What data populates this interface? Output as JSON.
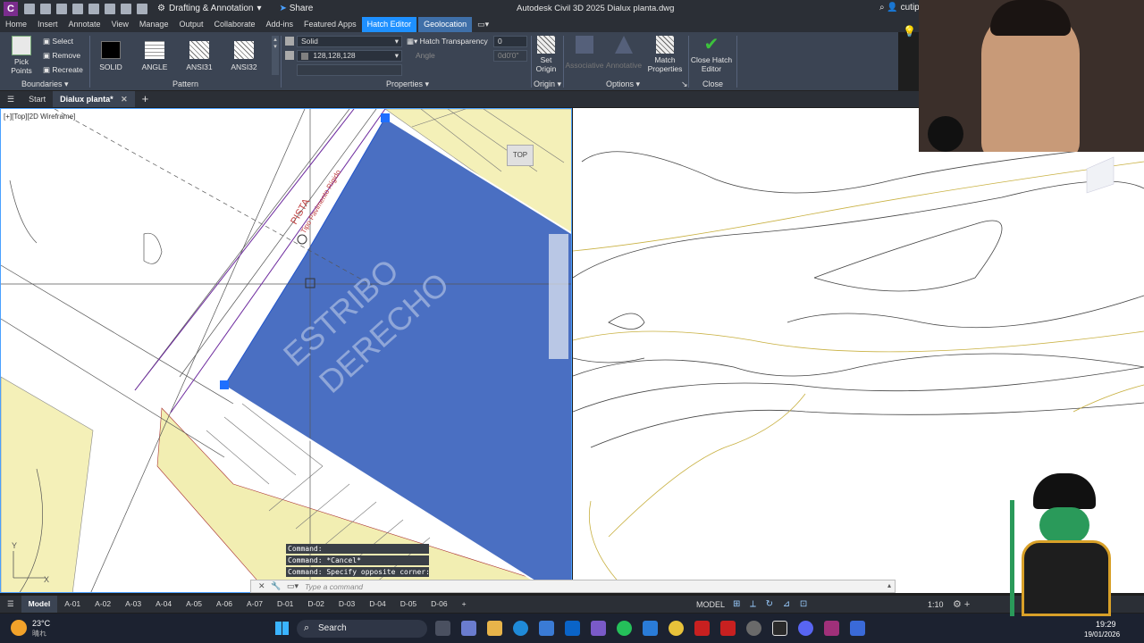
{
  "titlebar": {
    "workspace": "Drafting & Annotation",
    "share": "Share",
    "app_title": "Autodesk Civil 3D 2025    Dialux planta.dwg",
    "user": "cutipo.e",
    "logo": "C"
  },
  "menu": {
    "tabs": [
      "Home",
      "Insert",
      "Annotate",
      "View",
      "Manage",
      "Output",
      "Collaborate",
      "Add-ins",
      "Featured Apps",
      "Hatch Editor",
      "Geolocation"
    ],
    "active": "Hatch Editor"
  },
  "ribbon": {
    "boundaries": {
      "title": "Boundaries",
      "pick_points": "Pick Points",
      "select": "Select",
      "remove": "Remove",
      "recreate": "Recreate"
    },
    "pattern": {
      "title": "Pattern",
      "items": [
        "SOLID",
        "ANGLE",
        "ANSI31",
        "ANSI32"
      ]
    },
    "properties": {
      "title": "Properties",
      "type_value": "Solid",
      "color_value": "128,128,128",
      "transparency_label": "Hatch Transparency",
      "transparency_value": "0",
      "angle_label": "Angle",
      "angle_value": "0d0'0\""
    },
    "origin": {
      "title": "Origin",
      "set_origin": "Set Origin"
    },
    "options": {
      "title": "Options",
      "associative": "Associative",
      "annotative": "Annotative",
      "match_properties": "Match Properties"
    },
    "close": {
      "title": "Close",
      "close_hatch_editor": "Close Hatch Editor"
    }
  },
  "file_tabs": {
    "start": "Start",
    "active_file": "Dialux planta*",
    "add": "+"
  },
  "viewport": {
    "label": "[+][Top][2D Wireframe]",
    "viewcube": "TOP",
    "drawing_text_1": "ESTRIBO",
    "drawing_text_2": "DERECHO",
    "drawing_text_3": "PISTA",
    "drawing_text_4": "Tipo Pavimento Rígido"
  },
  "command": {
    "history": [
      "Command:",
      "Command: *Cancel*",
      "Command: Specify opposite corner:"
    ],
    "placeholder": "Type a command"
  },
  "layout_tabs": [
    "Model",
    "A-01",
    "A-02",
    "A-03",
    "A-04",
    "A-05",
    "A-06",
    "A-07",
    "D-01",
    "D-02",
    "D-03",
    "D-04",
    "D-05",
    "D-06"
  ],
  "status": {
    "model": "MODEL",
    "scale": "1:10"
  },
  "taskbar": {
    "temperature": "23°C",
    "weather": "晴れ",
    "search": "Search",
    "time": "19:29",
    "date": "19/01/2026"
  },
  "colors": {
    "hatch_blue": "#4a6fc2",
    "accent": "#1e90ff",
    "ribbon": "#3b4453",
    "dark": "#2b2f36"
  }
}
